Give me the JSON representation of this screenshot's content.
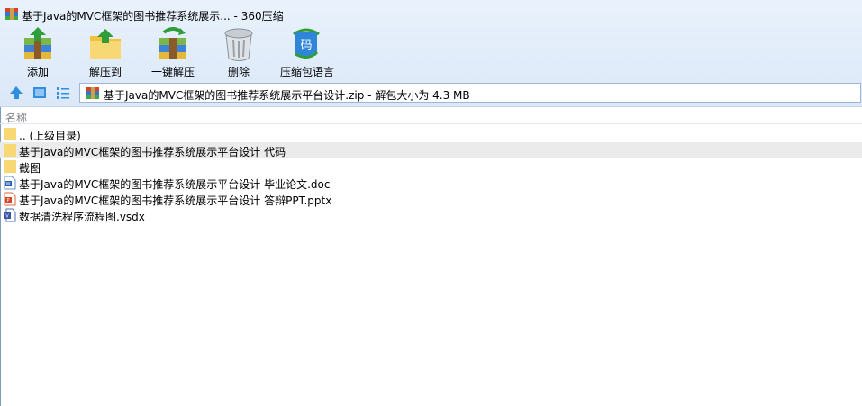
{
  "window": {
    "title": "基于Java的MVC框架的图书推荐系统展示... - 360压缩",
    "app_icon": "archive-icon"
  },
  "toolbar": {
    "items": [
      {
        "label": "添加",
        "icon": "add-archive-icon"
      },
      {
        "label": "解压到",
        "icon": "extract-to-icon"
      },
      {
        "label": "一键解压",
        "icon": "one-click-extract-icon"
      },
      {
        "label": "删除",
        "icon": "trash-icon"
      },
      {
        "label": "压缩包语言",
        "icon": "archive-language-icon"
      }
    ]
  },
  "navbar": {
    "up_icon": "up-arrow-icon",
    "large_view_icon": "large-icons-view-icon",
    "list_view_icon": "list-view-icon",
    "address": "基于Java的MVC框架的图书推荐系统展示平台设计.zip - 解包大小为 4.3 MB"
  },
  "file_list": {
    "column_header": "名称",
    "rows": [
      {
        "name": ".. (上级目录)",
        "icon": "folder-icon",
        "selected": false
      },
      {
        "name": "基于Java的MVC框架的图书推荐系统展示平台设计 代码",
        "icon": "folder-icon",
        "selected": true
      },
      {
        "name": "截图",
        "icon": "folder-icon",
        "selected": false
      },
      {
        "name": "基于Java的MVC框架的图书推荐系统展示平台设计 毕业论文.doc",
        "icon": "word-doc-icon",
        "selected": false
      },
      {
        "name": "基于Java的MVC框架的图书推荐系统展示平台设计 答辩PPT.pptx",
        "icon": "powerpoint-icon",
        "selected": false
      },
      {
        "name": "数据清洗程序流程图.vsdx",
        "icon": "visio-icon",
        "selected": false
      }
    ]
  },
  "colors": {
    "toolbar_bg": "#e2edfa",
    "selection": "#ebebeb",
    "folder": "#f8d775",
    "up_arrow": "#2f8fe0"
  }
}
